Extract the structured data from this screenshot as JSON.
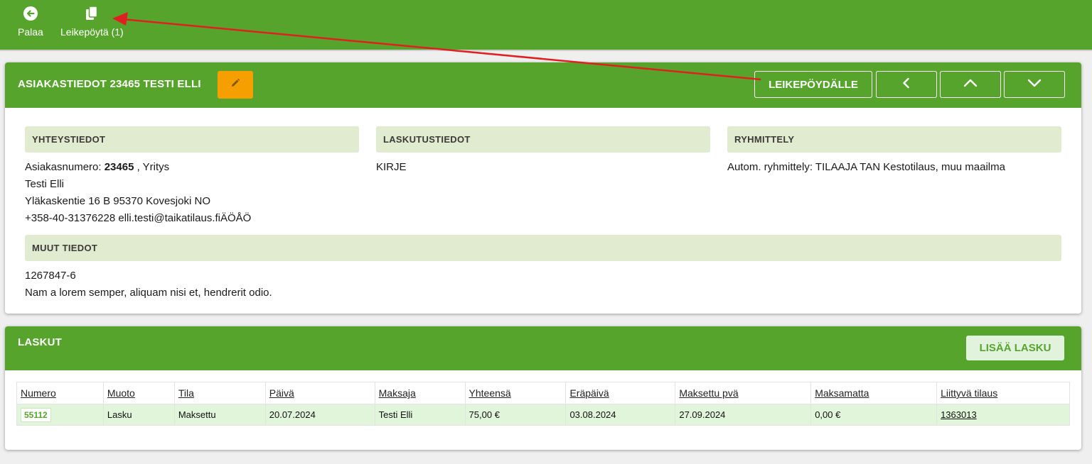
{
  "topbar": {
    "back_label": "Palaa",
    "clipboard_label": "Leikepöytä (1)"
  },
  "customer": {
    "title": "ASIAKASTIEDOT 23465 TESTI ELLI",
    "to_clipboard": "LEIKEPÖYDÄLLE",
    "contact": {
      "header": "YHTEYSTIEDOT",
      "number_prefix": "Asiakasnumero: ",
      "number": "23465",
      "number_suffix": " , Yritys",
      "name": "Testi Elli",
      "address": "Yläkaskentie 16 B 95370 Kovesjoki NO",
      "phone_email": "+358-40-31376228 elli.testi@taikatilaus.fiÄÖÅÖ"
    },
    "billing": {
      "header": "LASKUTUSTIEDOT",
      "method": "KIRJE"
    },
    "grouping": {
      "header": "RYHMITTELY",
      "text": "Autom. ryhmittely: TILAAJA TAN Kestotilaus, muu maailma"
    },
    "other": {
      "header": "MUUT TIEDOT",
      "line1": "1267847-6",
      "line2": "Nam a lorem semper, aliquam nisi et, hendrerit odio."
    }
  },
  "invoices": {
    "title": "LASKUT",
    "add_label": "LISÄÄ LASKU",
    "columns": [
      "Numero",
      "Muoto",
      "Tila",
      "Päivä",
      "Maksaja",
      "Yhteensä",
      "Eräpäivä",
      "Maksettu pvä",
      "Maksamatta",
      "Liittyvä tilaus"
    ],
    "rows": [
      [
        "55112",
        "Lasku",
        "Maksettu",
        "20.07.2024",
        "Testi Elli",
        "75,00 €",
        "03.08.2024",
        "27.09.2024",
        "0,00 €",
        "1363013"
      ]
    ]
  },
  "colors": {
    "brand_green": "#57a42d",
    "edit_orange": "#f5a000",
    "section_bg": "#e0ebcf",
    "row_bg": "#e1f5db",
    "annotation_arrow": "#e02020"
  }
}
